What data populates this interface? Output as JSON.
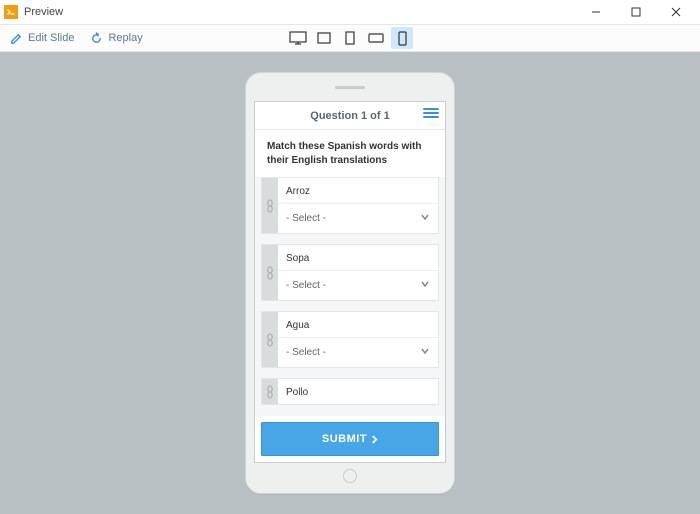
{
  "window": {
    "title": "Preview"
  },
  "toolbar": {
    "edit_slide": "Edit Slide",
    "replay": "Replay"
  },
  "question": {
    "header": "Question 1 of 1",
    "prompt": "Match these Spanish words with their English translations",
    "select_placeholder": "- Select -",
    "items": [
      {
        "label": "Arroz"
      },
      {
        "label": "Sopa"
      },
      {
        "label": "Agua"
      },
      {
        "label": "Pollo"
      }
    ],
    "submit": "SUBMIT"
  }
}
